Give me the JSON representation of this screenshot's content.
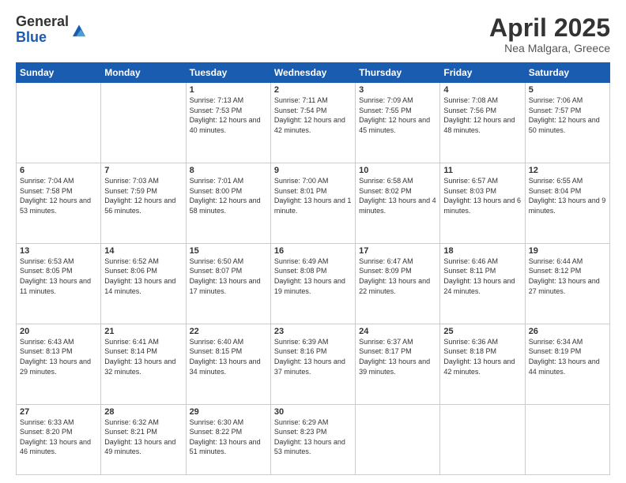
{
  "header": {
    "logo_general": "General",
    "logo_blue": "Blue",
    "title": "April 2025",
    "subtitle": "Nea Malgara, Greece"
  },
  "weekdays": [
    "Sunday",
    "Monday",
    "Tuesday",
    "Wednesday",
    "Thursday",
    "Friday",
    "Saturday"
  ],
  "weeks": [
    [
      {
        "day": "",
        "info": ""
      },
      {
        "day": "",
        "info": ""
      },
      {
        "day": "1",
        "info": "Sunrise: 7:13 AM\nSunset: 7:53 PM\nDaylight: 12 hours and 40 minutes."
      },
      {
        "day": "2",
        "info": "Sunrise: 7:11 AM\nSunset: 7:54 PM\nDaylight: 12 hours and 42 minutes."
      },
      {
        "day": "3",
        "info": "Sunrise: 7:09 AM\nSunset: 7:55 PM\nDaylight: 12 hours and 45 minutes."
      },
      {
        "day": "4",
        "info": "Sunrise: 7:08 AM\nSunset: 7:56 PM\nDaylight: 12 hours and 48 minutes."
      },
      {
        "day": "5",
        "info": "Sunrise: 7:06 AM\nSunset: 7:57 PM\nDaylight: 12 hours and 50 minutes."
      }
    ],
    [
      {
        "day": "6",
        "info": "Sunrise: 7:04 AM\nSunset: 7:58 PM\nDaylight: 12 hours and 53 minutes."
      },
      {
        "day": "7",
        "info": "Sunrise: 7:03 AM\nSunset: 7:59 PM\nDaylight: 12 hours and 56 minutes."
      },
      {
        "day": "8",
        "info": "Sunrise: 7:01 AM\nSunset: 8:00 PM\nDaylight: 12 hours and 58 minutes."
      },
      {
        "day": "9",
        "info": "Sunrise: 7:00 AM\nSunset: 8:01 PM\nDaylight: 13 hours and 1 minute."
      },
      {
        "day": "10",
        "info": "Sunrise: 6:58 AM\nSunset: 8:02 PM\nDaylight: 13 hours and 4 minutes."
      },
      {
        "day": "11",
        "info": "Sunrise: 6:57 AM\nSunset: 8:03 PM\nDaylight: 13 hours and 6 minutes."
      },
      {
        "day": "12",
        "info": "Sunrise: 6:55 AM\nSunset: 8:04 PM\nDaylight: 13 hours and 9 minutes."
      }
    ],
    [
      {
        "day": "13",
        "info": "Sunrise: 6:53 AM\nSunset: 8:05 PM\nDaylight: 13 hours and 11 minutes."
      },
      {
        "day": "14",
        "info": "Sunrise: 6:52 AM\nSunset: 8:06 PM\nDaylight: 13 hours and 14 minutes."
      },
      {
        "day": "15",
        "info": "Sunrise: 6:50 AM\nSunset: 8:07 PM\nDaylight: 13 hours and 17 minutes."
      },
      {
        "day": "16",
        "info": "Sunrise: 6:49 AM\nSunset: 8:08 PM\nDaylight: 13 hours and 19 minutes."
      },
      {
        "day": "17",
        "info": "Sunrise: 6:47 AM\nSunset: 8:09 PM\nDaylight: 13 hours and 22 minutes."
      },
      {
        "day": "18",
        "info": "Sunrise: 6:46 AM\nSunset: 8:11 PM\nDaylight: 13 hours and 24 minutes."
      },
      {
        "day": "19",
        "info": "Sunrise: 6:44 AM\nSunset: 8:12 PM\nDaylight: 13 hours and 27 minutes."
      }
    ],
    [
      {
        "day": "20",
        "info": "Sunrise: 6:43 AM\nSunset: 8:13 PM\nDaylight: 13 hours and 29 minutes."
      },
      {
        "day": "21",
        "info": "Sunrise: 6:41 AM\nSunset: 8:14 PM\nDaylight: 13 hours and 32 minutes."
      },
      {
        "day": "22",
        "info": "Sunrise: 6:40 AM\nSunset: 8:15 PM\nDaylight: 13 hours and 34 minutes."
      },
      {
        "day": "23",
        "info": "Sunrise: 6:39 AM\nSunset: 8:16 PM\nDaylight: 13 hours and 37 minutes."
      },
      {
        "day": "24",
        "info": "Sunrise: 6:37 AM\nSunset: 8:17 PM\nDaylight: 13 hours and 39 minutes."
      },
      {
        "day": "25",
        "info": "Sunrise: 6:36 AM\nSunset: 8:18 PM\nDaylight: 13 hours and 42 minutes."
      },
      {
        "day": "26",
        "info": "Sunrise: 6:34 AM\nSunset: 8:19 PM\nDaylight: 13 hours and 44 minutes."
      }
    ],
    [
      {
        "day": "27",
        "info": "Sunrise: 6:33 AM\nSunset: 8:20 PM\nDaylight: 13 hours and 46 minutes."
      },
      {
        "day": "28",
        "info": "Sunrise: 6:32 AM\nSunset: 8:21 PM\nDaylight: 13 hours and 49 minutes."
      },
      {
        "day": "29",
        "info": "Sunrise: 6:30 AM\nSunset: 8:22 PM\nDaylight: 13 hours and 51 minutes."
      },
      {
        "day": "30",
        "info": "Sunrise: 6:29 AM\nSunset: 8:23 PM\nDaylight: 13 hours and 53 minutes."
      },
      {
        "day": "",
        "info": ""
      },
      {
        "day": "",
        "info": ""
      },
      {
        "day": "",
        "info": ""
      }
    ]
  ]
}
